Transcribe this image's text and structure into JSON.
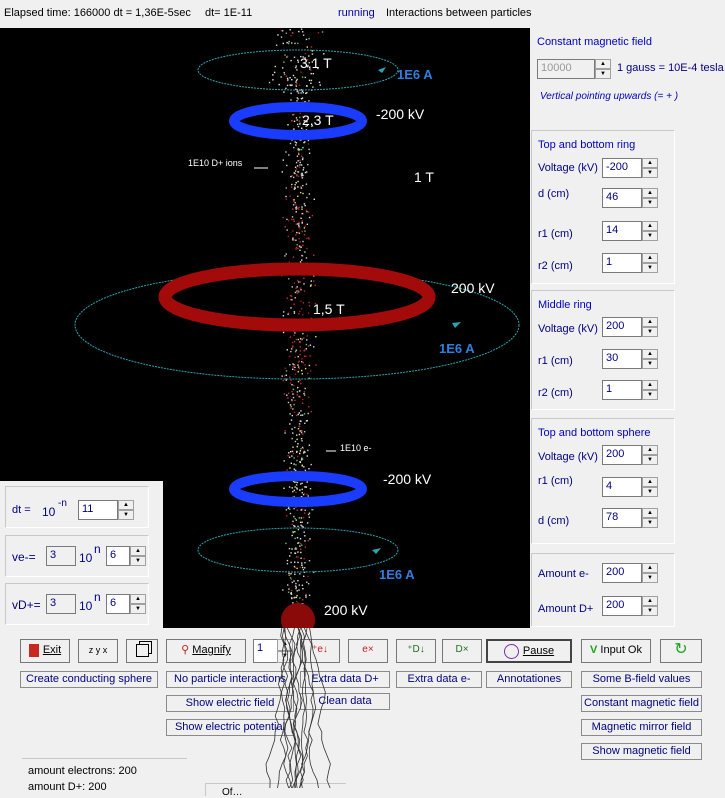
{
  "topbar": {
    "elapsed": "Elapsed time: 166000 dt   = 1,36E-5sec",
    "dt": "dt= 1E-11",
    "status": "running",
    "interactions": "Interactions between particles"
  },
  "canvas": {
    "labels": {
      "top_field": "3,1 T",
      "top_current": "1E6 A",
      "top_ring_field": "2,3 T",
      "top_ring_voltage": "-200 kV",
      "ions": "1E10 D+ ions",
      "mid_field": "1 T",
      "mid_ring_voltage": "200 kV",
      "mid_ring_field": "1,5 T",
      "mid_current": "1E6 A",
      "electrons": "1E10 e-",
      "bot_ring_voltage": "-200 kV",
      "bot_current": "1E6 A",
      "sphere_voltage": "200 kV"
    },
    "colors": {
      "background": "#000000",
      "blue_ring": "#1a3cff",
      "red_ring": "#a30b0b",
      "loop": "#2aa6b0",
      "label_blue": "#2e7fe0"
    }
  },
  "magnetic": {
    "title": "Constant magnetic field",
    "value": "10000",
    "unit": "1 gauss = 10E-4 tesla",
    "note": "Vertical pointing upwards (= + )"
  },
  "ring_tb": {
    "title": "Top and bottom ring",
    "voltage_label": "Voltage (kV)",
    "voltage": "-200",
    "d_label": "d (cm)",
    "d": "46",
    "r1_label": "r1 (cm)",
    "r1": "14",
    "r2_label": "r2 (cm)",
    "r2": "1"
  },
  "ring_mid": {
    "title": "Middle ring",
    "voltage_label": "Voltage (kV)",
    "voltage": "200",
    "r1_label": "r1 (cm)",
    "r1": "30",
    "r2_label": "r2 (cm)",
    "r2": "1"
  },
  "sphere_tb": {
    "title": "Top and bottom sphere",
    "voltage_label": "Voltage (kV)",
    "voltage": "200",
    "r1_label": "r1 (cm)",
    "r1": "4",
    "d_label": "d (cm)",
    "d": "78"
  },
  "amounts": {
    "e_label": "Amount e-",
    "e": "200",
    "d_label": "Amount D+",
    "d": "200"
  },
  "left_params": {
    "dt_label": "dt =",
    "dt_base": "10",
    "dt_exp": "-n",
    "dt_val": "11",
    "ve_label": "ve-=",
    "ve_mant": "3",
    "ve_base": "10",
    "ve_exp": "n",
    "ve_val": "6",
    "vd_label": "vD+=",
    "vd_mant": "3",
    "vd_base": "10",
    "vd_exp": "n",
    "vd_val": "6"
  },
  "toolbar": {
    "exit": "Exit",
    "axes": "z y x",
    "magnify": "Magnify",
    "magnify_value": "1",
    "pause": "Pause",
    "input_ok": "Input Ok"
  },
  "buttons": {
    "create_sphere": "Create conducting sphere",
    "no_interactions": "No particle interactions",
    "extra_d": "Extra data D+",
    "extra_e": "Extra data e-",
    "annotations": "Annotationes",
    "some_b": "Some B-field values",
    "show_efield": "Show electric field",
    "clean": "Clean data",
    "const_field": "Constant magnetic field",
    "show_potential": "Show electric potential",
    "mirror": "Magnetic mirror field",
    "show_mfield": "Show magnetic field"
  },
  "status": {
    "electrons": "amount electrons: 200",
    "ions": "amount D+: 200",
    "cut": "Of…"
  }
}
